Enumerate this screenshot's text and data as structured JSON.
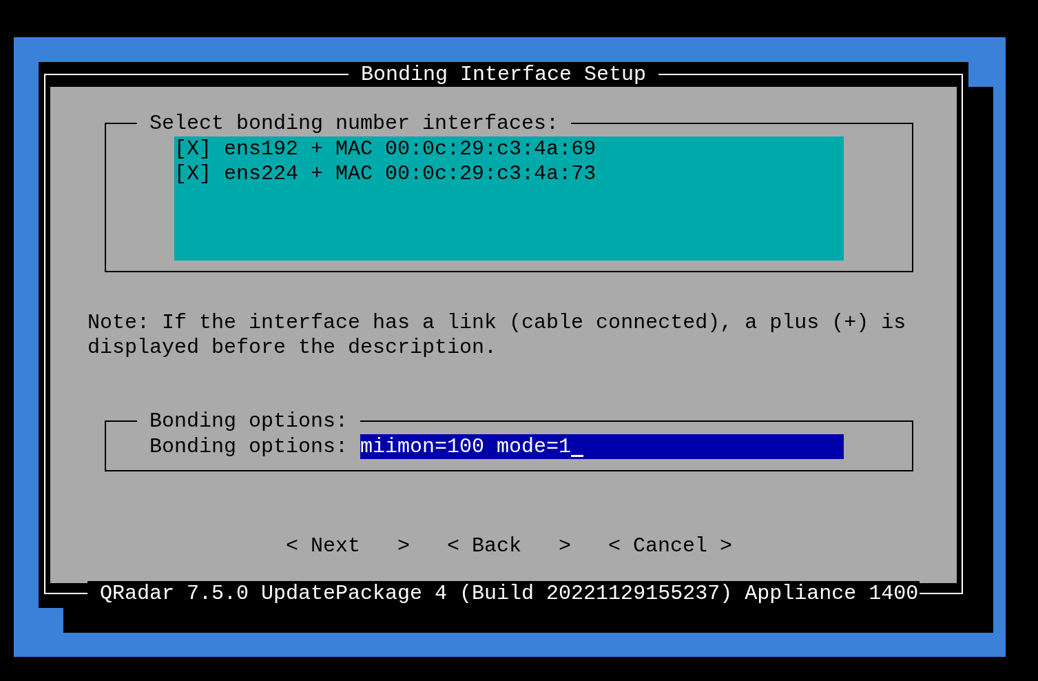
{
  "dialog": {
    "title": "Bonding Interface Setup",
    "footer": "QRadar 7.5.0 UpdatePackage 4 (Build 20221129155237) Appliance 1400"
  },
  "interfaces": {
    "heading": "Select bonding number interfaces:",
    "items": [
      {
        "mark": "[X]",
        "label": "ens192 + MAC 00:0c:29:c3:4a:69",
        "checked": true
      },
      {
        "mark": "[X]",
        "label": "ens224 + MAC 00:0c:29:c3:4a:73",
        "checked": true
      }
    ]
  },
  "note": "Note: If the interface has a link (cable connected), a plus (+) is displayed before the description.",
  "bonding_options": {
    "heading": "Bonding options:",
    "label": "Bonding options:",
    "value": "miimon=100 mode=1",
    "focused": true
  },
  "buttons": [
    "< Next   >",
    "< Back   >",
    "< Cancel >"
  ]
}
